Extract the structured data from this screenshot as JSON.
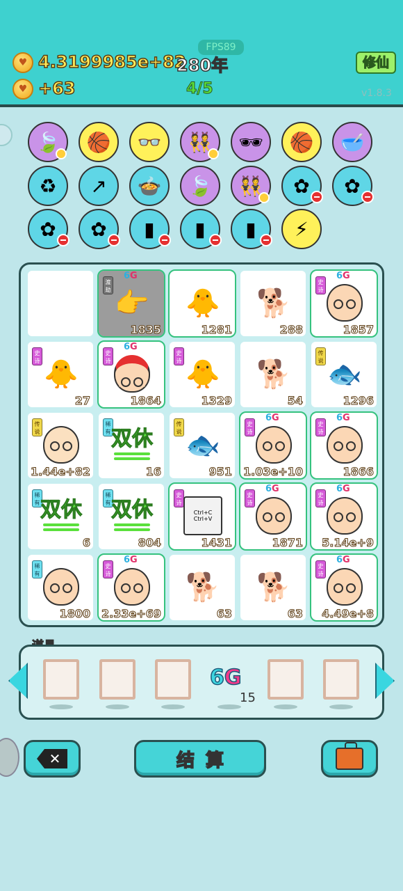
{
  "header": {
    "coins": "4.3199985e+82",
    "years": "280年",
    "income": "+63",
    "fps": "FPS89",
    "generation": "4/5",
    "xiuxian_button": "修仙",
    "version": "v1.8.3"
  },
  "collection_row1": [
    "leaf-icon",
    "basketball-icon",
    "glasses-icon",
    "girls-icon",
    "sunglasses-icon",
    "basketball-icon",
    "dogbowl-icon"
  ],
  "collection_row2": [
    "trashbag-icon",
    "arrow-card-icon",
    "pot-icon",
    "leaf-icon",
    "girls-icon",
    "flower-icon",
    "flower-icon"
  ],
  "collection_row3": [
    "flower-icon",
    "flower-icon",
    "bottle-icon",
    "bottle-icon",
    "bottle-icon",
    "lightning-icon"
  ],
  "board": {
    "rows": [
      [
        {
          "kind": "empty",
          "value": ""
        },
        {
          "kind": "hand",
          "tag": "渡劫",
          "g6": true,
          "value": "1835"
        },
        {
          "kind": "chick",
          "tag": "",
          "g6": false,
          "value": "1281"
        },
        {
          "kind": "dog",
          "tag": "",
          "g6": false,
          "value": "288"
        },
        {
          "kind": "oldman",
          "tag": "史诗",
          "g6": true,
          "value": "1857"
        }
      ],
      [
        {
          "kind": "chick",
          "tag": "史诗",
          "g6": false,
          "value": "27"
        },
        {
          "kind": "redhair",
          "tag": "史诗",
          "g6": true,
          "value": "1864"
        },
        {
          "kind": "chick",
          "tag": "史诗",
          "g6": false,
          "value": "1329"
        },
        {
          "kind": "dog",
          "tag": "",
          "g6": false,
          "value": "54"
        },
        {
          "kind": "fish",
          "tag": "传说",
          "g6": false,
          "value": "1296"
        }
      ],
      [
        {
          "kind": "smileman",
          "tag": "传说",
          "g6": false,
          "value": "1.44e+82"
        },
        {
          "kind": "shuangxiu",
          "tag": "稀有",
          "g6": false,
          "value": "16"
        },
        {
          "kind": "fish",
          "tag": "传说",
          "g6": false,
          "value": "951"
        },
        {
          "kind": "oldman",
          "tag": "史诗",
          "g6": true,
          "value": "1.03e+10"
        },
        {
          "kind": "oldman",
          "tag": "史诗",
          "g6": true,
          "value": "1866"
        }
      ],
      [
        {
          "kind": "shuangxiu",
          "tag": "稀有",
          "g6": false,
          "value": "6"
        },
        {
          "kind": "shuangxiu",
          "tag": "稀有",
          "g6": false,
          "value": "804"
        },
        {
          "kind": "ctrl",
          "tag": "史诗",
          "g6": false,
          "value": "1431"
        },
        {
          "kind": "oldman",
          "tag": "史诗",
          "g6": true,
          "value": "1871"
        },
        {
          "kind": "oldman",
          "tag": "史诗",
          "g6": true,
          "value": "5.14e+9"
        }
      ],
      [
        {
          "kind": "baldman",
          "tag": "稀有",
          "g6": false,
          "value": "1800"
        },
        {
          "kind": "oldman",
          "tag": "史诗",
          "g6": true,
          "value": "2.33e+69"
        },
        {
          "kind": "dog",
          "tag": "",
          "g6": false,
          "value": "63"
        },
        {
          "kind": "dog",
          "tag": "",
          "g6": false,
          "value": "63"
        },
        {
          "kind": "oldman",
          "tag": "史诗",
          "g6": true,
          "value": "4.49e+8"
        }
      ]
    ],
    "shuangxiu_text": "双休",
    "ctrl_c": "Ctrl+C",
    "ctrl_v": "Ctrl+V",
    "g6_prefix": "6",
    "g6_suffix": "G"
  },
  "props": {
    "label": "道具",
    "g6_prefix": "6",
    "g6_suffix": "G",
    "g6_count": "15"
  },
  "actions": {
    "settle_label": "结算",
    "delete_label": "✕"
  }
}
